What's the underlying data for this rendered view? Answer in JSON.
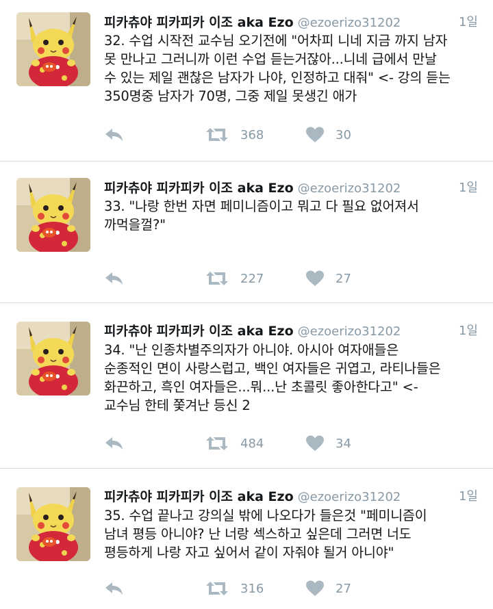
{
  "colors": {
    "text": "#14171a",
    "secondary": "#8899a6",
    "action_icon": "#aab8c2",
    "divider": "#d8dde2"
  },
  "tweets": [
    {
      "author_name": "피카츄야 피카피카 이조 aka Ezo",
      "handle": "@ezoerizo31202",
      "time": "1일",
      "lines": [
        "32. 수업 시작전 교수님 오기전에 \"어차피 니네 지금 까지 남자",
        "못 만나고 그러니까 이런 수업 듣는거잖아...니네 급에서 만날",
        "수 있는 제일 괜찮은 남자가 나야, 인정하고 대줘\" <- 강의 듣는",
        "350명중 남자가 70명, 그중 제일 못생긴 애가"
      ],
      "retweets": "368",
      "likes": "30",
      "reply_icon": "reply-icon",
      "retweet_icon": "retweet-icon",
      "like_icon": "heart-icon"
    },
    {
      "author_name": "피카츄야 피카피카 이조 aka Ezo",
      "handle": "@ezoerizo31202",
      "time": "1일",
      "lines": [
        "33. \"나랑 한번 자면 페미니즘이고 뭐고 다 필요 없어져서",
        "까먹을껄?\""
      ],
      "retweets": "227",
      "likes": "27",
      "reply_icon": "reply-icon",
      "retweet_icon": "retweet-icon",
      "like_icon": "heart-icon"
    },
    {
      "author_name": "피카츄야 피카피카 이조 aka Ezo",
      "handle": "@ezoerizo31202",
      "time": "1일",
      "lines": [
        "34. \"난 인종차별주의자가 아니야. 아시아 여자애들은",
        "순종적인 면이 사랑스럽고, 백인 여자들은 귀엽고, 라티나들은",
        "화끈하고, 흑인 여자들은...뭐...난 초콜릿 좋아한다고\" <-",
        "교수님 한테 쫓겨난 등신 2"
      ],
      "retweets": "484",
      "likes": "34",
      "reply_icon": "reply-icon",
      "retweet_icon": "retweet-icon",
      "like_icon": "heart-icon"
    },
    {
      "author_name": "피카츄야 피카피카 이조 aka Ezo",
      "handle": "@ezoerizo31202",
      "time": "1일",
      "lines": [
        "35. 수업 끝나고 강의실 밖에 나오다가 들은것 \"페미니즘이",
        "남녀 평등 아니야? 난 너랑 섹스하고 싶은데 그러면 너도",
        "평등하게 나랑 자고 싶어서 같이 자줘야 될거 아니야\""
      ],
      "retweets": "316",
      "likes": "27",
      "reply_icon": "reply-icon",
      "retweet_icon": "retweet-icon",
      "like_icon": "heart-icon"
    }
  ]
}
